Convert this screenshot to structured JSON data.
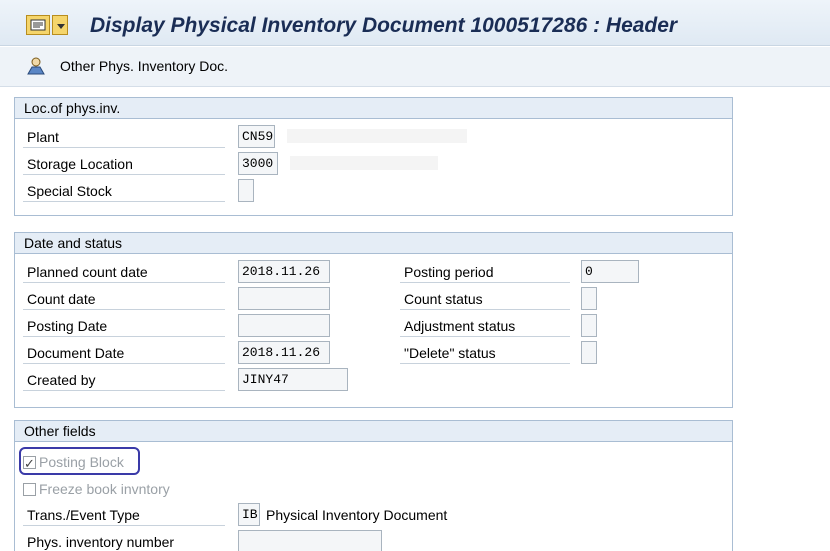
{
  "header": {
    "title": "Display Physical Inventory Document 1000517286 : Header"
  },
  "toolbar": {
    "other_doc_label": "Other Phys. Inventory Doc."
  },
  "loc_group": {
    "title": "Loc.of phys.inv.",
    "plant_label": "Plant",
    "plant_value": "CN59",
    "storage_label": "Storage Location",
    "storage_value": "3000",
    "special_stock_label": "Special Stock",
    "special_stock_value": ""
  },
  "date_group": {
    "title": "Date and status",
    "planned_count_label": "Planned count date",
    "planned_count_value": "2018.11.26",
    "count_date_label": "Count date",
    "count_date_value": "",
    "posting_date_label": "Posting Date",
    "posting_date_value": "",
    "document_date_label": "Document Date",
    "document_date_value": "2018.11.26",
    "created_by_label": "Created by",
    "created_by_value": "JINY47",
    "posting_period_label": "Posting period",
    "posting_period_value": "0",
    "count_status_label": "Count status",
    "count_status_value": "",
    "adjustment_status_label": "Adjustment status",
    "adjustment_status_value": "",
    "delete_status_label": "\"Delete\" status",
    "delete_status_value": ""
  },
  "other_group": {
    "title": "Other fields",
    "posting_block_label": "Posting Block",
    "posting_block_checked": true,
    "freeze_label": "Freeze book invntory",
    "freeze_checked": false,
    "trans_event_label": "Trans./Event Type",
    "trans_event_value": "IB",
    "trans_event_desc": "Physical Inventory Document",
    "phys_inv_number_label": "Phys. inventory number",
    "phys_inv_number_value": ""
  },
  "colors": {
    "title_text": "#1a2d55",
    "group_border": "#a9bdd3",
    "group_header_bg": "#e5edf6",
    "highlight": "#3a3aa8"
  }
}
